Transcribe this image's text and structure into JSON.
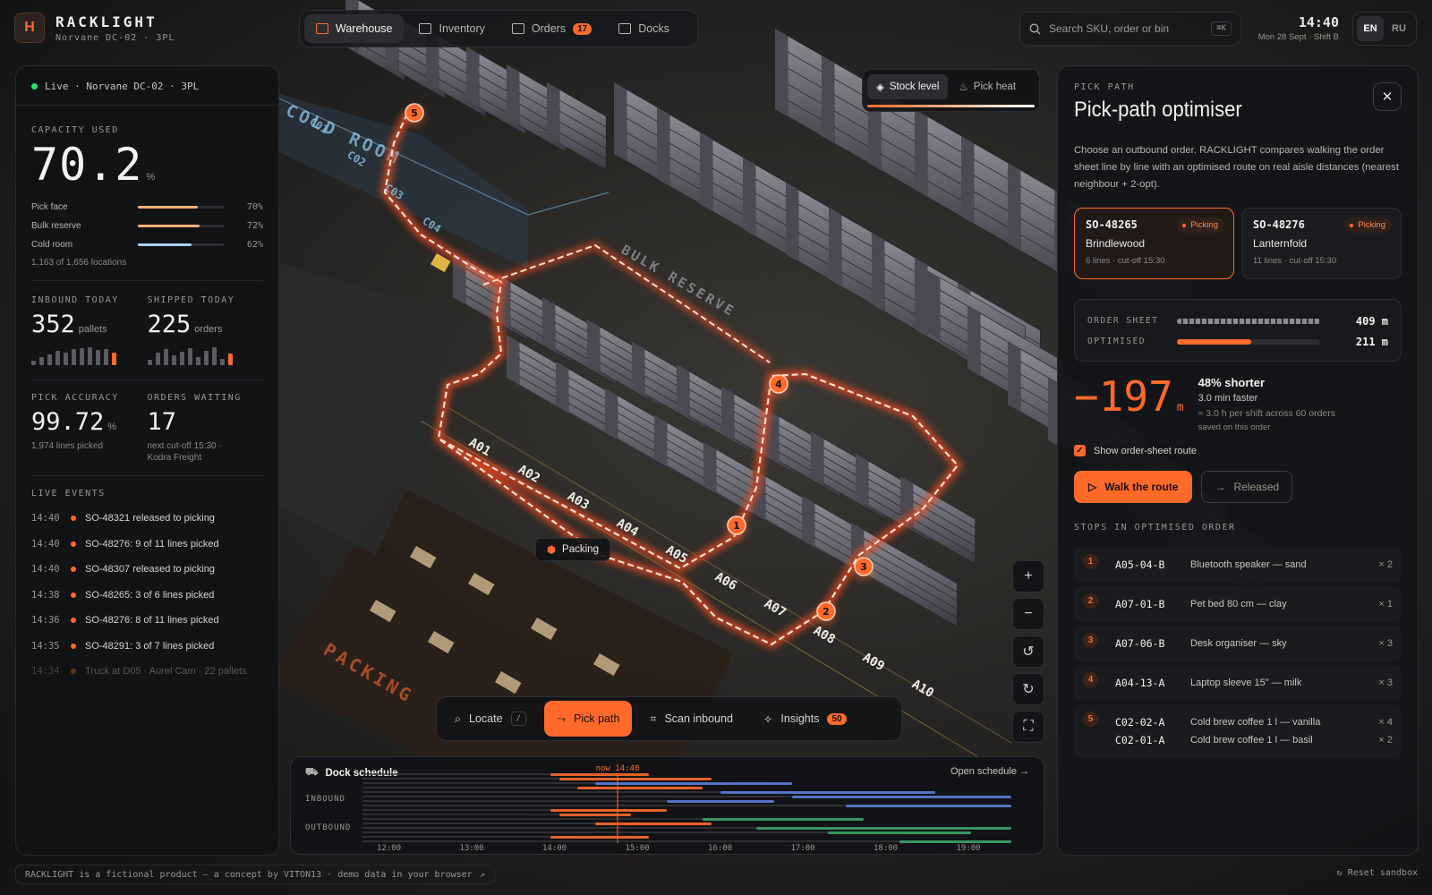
{
  "brand": {
    "logo": "H",
    "title": "RACKLIGHT",
    "subtitle": "Norvane DC-02 · 3PL"
  },
  "nav": [
    {
      "label": "Warehouse",
      "icon": "warehouse-icon"
    },
    {
      "label": "Inventory",
      "icon": "grid-icon"
    },
    {
      "label": "Orders",
      "icon": "clipboard-icon",
      "badge": "17"
    },
    {
      "label": "Docks",
      "icon": "truck-icon"
    }
  ],
  "search": {
    "placeholder": "Search SKU, order or bin",
    "shortcut": "⌘K"
  },
  "clock": {
    "time": "14:40",
    "date": "Mon 28 Sept · Shift B"
  },
  "lang": {
    "en": "EN",
    "ru": "RU"
  },
  "left": {
    "live": "Live · Norvane DC-02 · 3PL",
    "capacity_label": "CAPACITY USED",
    "capacity_value": "70.2",
    "capacity_unit": "%",
    "zones": [
      {
        "name": "Pick face",
        "pct": "70%",
        "value": 0.7,
        "color": "#ffb07c"
      },
      {
        "name": "Bulk reserve",
        "pct": "72%",
        "value": 0.72,
        "color": "#ffb07c"
      },
      {
        "name": "Cold room",
        "pct": "62%",
        "value": 0.62,
        "color": "#a9d2ff"
      }
    ],
    "locations": "1,163 of 1,656 locations",
    "inbound_label": "INBOUND TODAY",
    "inbound_value": "352",
    "inbound_unit": "pallets",
    "shipped_label": "SHIPPED TODAY",
    "shipped_value": "225",
    "shipped_unit": "orders",
    "accuracy_label": "PICK ACCURACY",
    "accuracy_value": "99.72",
    "accuracy_unit": "%",
    "accuracy_sub": "1,974 lines picked",
    "waiting_label": "ORDERS WAITING",
    "waiting_value": "17",
    "waiting_sub1": "next cut-off 15:30 ·",
    "waiting_sub2": "Kodra Freight",
    "events_label": "LIVE EVENTS",
    "events": [
      {
        "time": "14:40",
        "text": "SO-48321 released to picking"
      },
      {
        "time": "14:40",
        "text": "SO-48276: 9 of 11 lines picked"
      },
      {
        "time": "14:40",
        "text": "SO-48307 released to picking"
      },
      {
        "time": "14:38",
        "text": "SO-48265: 3 of 6 lines picked"
      },
      {
        "time": "14:36",
        "text": "SO-48276: 8 of 11 lines picked"
      },
      {
        "time": "14:35",
        "text": "SO-48291: 3 of 7 lines picked"
      },
      {
        "time": "14:34",
        "text": "Truck at D05 · Aurel Cam · 22 pallets"
      }
    ]
  },
  "map": {
    "stock_level": "Stock level",
    "pick_heat": "Pick heat",
    "packing_tag": "Packing",
    "aisles": [
      "A01",
      "A02",
      "A03",
      "A04",
      "A05",
      "A06",
      "A07",
      "A08",
      "A09",
      "A10"
    ],
    "cold_aisles": [
      "C01",
      "C02",
      "C03",
      "C04"
    ],
    "zone_cold": "COLD ROOM",
    "zone_bulk": "BULK RESERVE",
    "zone_packing": "PACKING",
    "stops": [
      "1",
      "2",
      "3",
      "4",
      "5"
    ]
  },
  "toolbar": {
    "locate": "Locate",
    "locate_key": "/",
    "pick_path": "Pick path",
    "scan": "Scan inbound",
    "insights": "Insights",
    "insights_badge": "50"
  },
  "dock": {
    "title": "Dock schedule",
    "open": "Open schedule",
    "inbound": "INBOUND",
    "outbound": "OUTBOUND",
    "now": "now 14:40",
    "ticks": [
      "12:00",
      "13:00",
      "14:00",
      "15:00",
      "16:00",
      "17:00",
      "18:00",
      "19:00"
    ]
  },
  "right": {
    "eyebrow": "PICK PATH",
    "title": "Pick-path optimiser",
    "desc": "Choose an outbound order. RACKLIGHT compares walking the order sheet line by line with an optimised route on real aisle distances (nearest neighbour + 2-opt).",
    "orders": [
      {
        "id": "SO-48265",
        "name": "Brindlewood",
        "sub": "6 lines · cut-off 15:30",
        "status": "Picking"
      },
      {
        "id": "SO-48276",
        "name": "Lanternfold",
        "sub": "11 lines · cut-off 15:30",
        "status": "Picking"
      }
    ],
    "sheet_label": "ORDER SHEET",
    "sheet_value": "409 m",
    "opt_label": "OPTIMISED",
    "opt_value": "211 m",
    "saving": "−197",
    "saving_unit": "m",
    "shorter": "48% shorter",
    "faster": "3.0 min faster",
    "per_shift": "≈ 3.0 h per shift across 60 orders",
    "saved": "saved on this order",
    "show_route": "Show order-sheet route",
    "walk": "Walk the route",
    "released": "Released",
    "stops_label": "STOPS IN OPTIMISED ORDER",
    "stops": [
      {
        "n": "1",
        "loc": "A05-04-B",
        "item": "Bluetooth speaker — sand",
        "qty": "× 2"
      },
      {
        "n": "2",
        "loc": "A07-01-B",
        "item": "Pet bed 80 cm — clay",
        "qty": "× 1"
      },
      {
        "n": "3",
        "loc": "A07-06-B",
        "item": "Desk organiser — sky",
        "qty": "× 3"
      },
      {
        "n": "4",
        "loc": "A04-13-A",
        "item": "Laptop sleeve 15\" — milk",
        "qty": "× 3"
      },
      {
        "n": "5",
        "loc": "C02-02-A",
        "item": "Cold brew coffee 1 l — vanilla",
        "qty": "× 4",
        "loc2": "C02-01-A",
        "item2": "Cold brew coffee 1 l — basil",
        "qty2": "× 2"
      }
    ]
  },
  "footer": {
    "text": "RACKLIGHT is a fictional product — a concept by VITON13 · demo data in your browser",
    "reset": "Reset sandbox"
  },
  "colors": {
    "accent": "#ff6a2b",
    "live": "#2ee36f",
    "cold": "#a9d2ff"
  }
}
